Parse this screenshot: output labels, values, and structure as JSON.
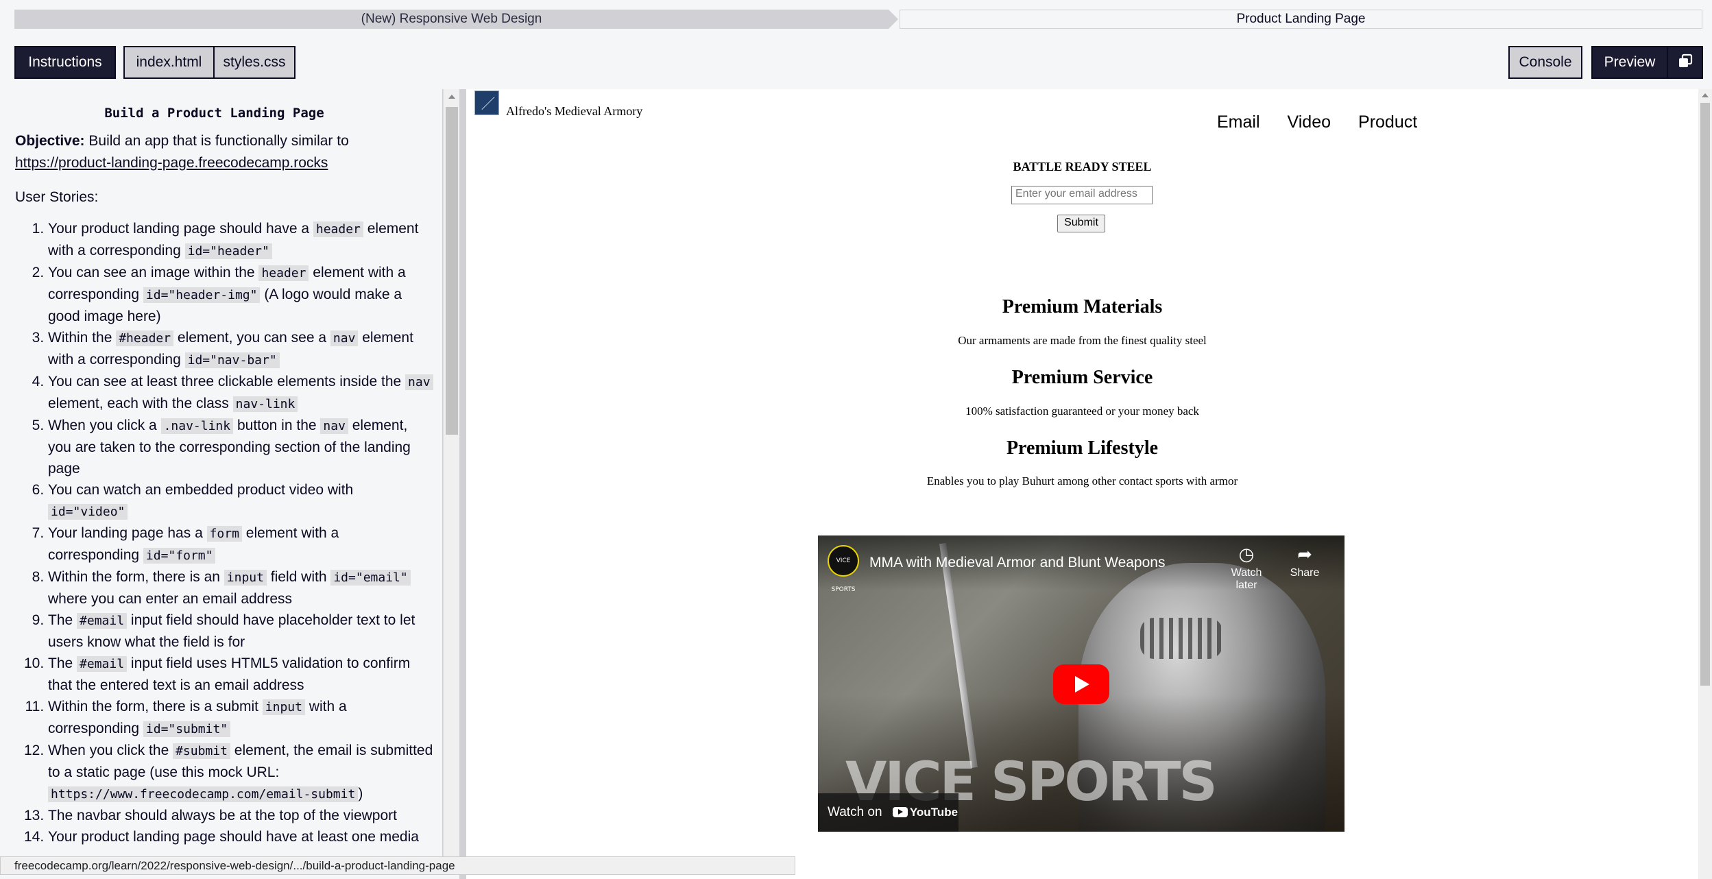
{
  "breadcrumb": {
    "course": "(New) Responsive Web Design",
    "project": "Product Landing Page"
  },
  "toolbar": {
    "instructions": "Instructions",
    "file1": "index.html",
    "file2": "styles.css",
    "console": "Console",
    "preview": "Preview",
    "popout_icon": "popout-icon"
  },
  "instructions": {
    "title": "Build a Product Landing Page",
    "objective_label": "Objective:",
    "objective_text": "Build an app that is functionally similar to",
    "objective_link": "https://product-landing-page.freecodecamp.rocks",
    "stories_heading": "User Stories:",
    "stories": [
      [
        "Your product landing page should have a ",
        {
          "c": "header"
        },
        " element with a corresponding ",
        {
          "c": "id=\"header\""
        }
      ],
      [
        "You can see an image within the ",
        {
          "c": "header"
        },
        " element with a corresponding ",
        {
          "c": "id=\"header-img\""
        },
        " (A logo would make a good image here)"
      ],
      [
        "Within the ",
        {
          "c": "#header"
        },
        " element, you can see a ",
        {
          "c": "nav"
        },
        " element with a corresponding ",
        {
          "c": "id=\"nav-bar\""
        }
      ],
      [
        "You can see at least three clickable elements inside the ",
        {
          "c": "nav"
        },
        " element, each with the class ",
        {
          "c": "nav-link"
        }
      ],
      [
        "When you click a ",
        {
          "c": ".nav-link"
        },
        " button in the ",
        {
          "c": "nav"
        },
        " element, you are taken to the corresponding section of the landing page"
      ],
      [
        "You can watch an embedded product video with ",
        {
          "c": "id=\"video\""
        }
      ],
      [
        "Your landing page has a ",
        {
          "c": "form"
        },
        " element with a corresponding ",
        {
          "c": "id=\"form\""
        }
      ],
      [
        "Within the form, there is an ",
        {
          "c": "input"
        },
        " field with ",
        {
          "c": "id=\"email\""
        },
        " where you can enter an email address"
      ],
      [
        "The ",
        {
          "c": "#email"
        },
        " input field should have placeholder text to let users know what the field is for"
      ],
      [
        "The ",
        {
          "c": "#email"
        },
        " input field uses HTML5 validation to confirm that the entered text is an email address"
      ],
      [
        "Within the form, there is a submit ",
        {
          "c": "input"
        },
        " with a corresponding ",
        {
          "c": "id=\"submit\""
        }
      ],
      [
        "When you click the ",
        {
          "c": "#submit"
        },
        " element, the email is submitted to a static page (use this mock URL: ",
        {
          "c": "https://www.freecodecamp.com/email-submit"
        },
        ")"
      ],
      [
        "The navbar should always be at the top of the viewport"
      ],
      [
        "Your product landing page should have at least one media"
      ]
    ]
  },
  "preview": {
    "brand": "Alfredo's Medieval Armory",
    "nav": [
      "Email",
      "Video",
      "Product"
    ],
    "hero_title": "BATTLE READY STEEL",
    "email_placeholder": "Enter your email address",
    "submit_label": "Submit",
    "features": [
      {
        "title": "Premium Materials",
        "text": "Our armaments are made from the finest quality steel"
      },
      {
        "title": "Premium Service",
        "text": "100% satisfaction guaranteed or your money back"
      },
      {
        "title": "Premium Lifestyle",
        "text": "Enables you to play Buhurt among other contact sports with armor"
      }
    ],
    "video": {
      "channel_badge": "VICE SPORTS",
      "title": "MMA with Medieval Armor and Blunt Weapons",
      "watch_later": "Watch later",
      "share": "Share",
      "watermark": "VICE SPORTS",
      "watch_on": "Watch on",
      "youtube": "YouTube"
    }
  },
  "status_url": "freecodecamp.org/learn/2022/responsive-web-design/.../build-a-product-landing-page"
}
